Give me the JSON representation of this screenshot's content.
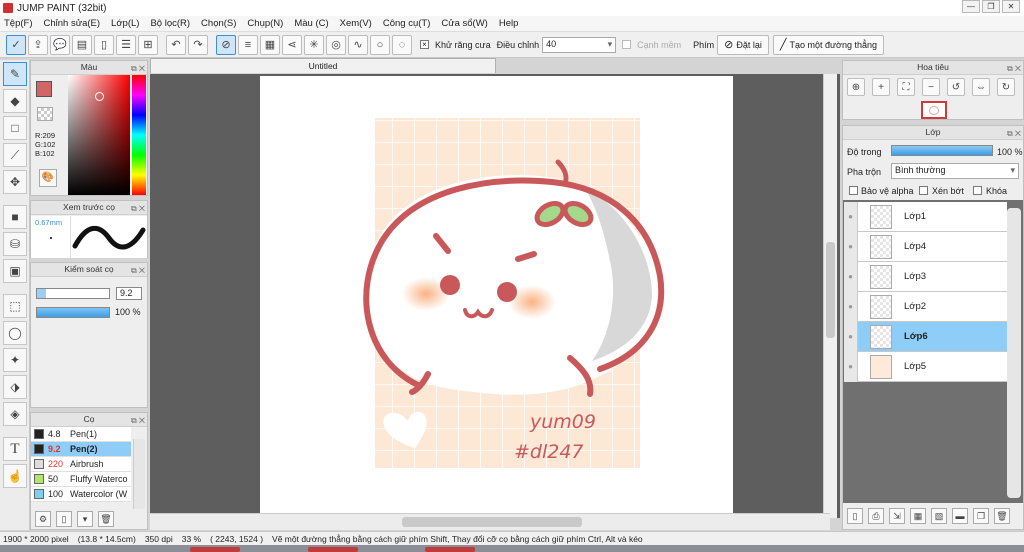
{
  "window": {
    "title": "JUMP PAINT (32bit)"
  },
  "menu": [
    "Tệp(F)",
    "Chỉnh sửa(E)",
    "Lớp(L)",
    "Bộ lọc(R)",
    "Chọn(S)",
    "Chụp(N)",
    "Màu (C)",
    "Xem(V)",
    "Công cụ(T)",
    "Cửa sổ(W)",
    "Help"
  ],
  "toolbar": {
    "antialias_label": "Khử răng cưa",
    "adjust_label": "Điều chỉnh",
    "adjust_value": "40",
    "smooth_label": "Cạnh mềm",
    "key_label": "Phím",
    "reset_label": "Đặt lại",
    "straight_label": "Tạo một đường thẳng"
  },
  "document": {
    "tab_title": "Untitled"
  },
  "color_panel": {
    "title": "Màu",
    "r": "R:209",
    "g": "G:102",
    "b": "B:102",
    "fg_color": "#d16666"
  },
  "brush_preview": {
    "title": "Xem trước cọ",
    "size": "0.67mm"
  },
  "brush_control": {
    "title": "Kiểm soát cọ",
    "size_value": "9.2",
    "opacity_value": "100 %"
  },
  "brushes": {
    "title": "Cọ",
    "items": [
      {
        "size": "4.8",
        "name": "Pen(1)",
        "color": "#222222"
      },
      {
        "size": "9.2",
        "name": "Pen(2)",
        "color": "#222222",
        "selected": true
      },
      {
        "size": "220",
        "name": "Airbrush",
        "color": "#dddddd",
        "size_red": true
      },
      {
        "size": "50",
        "name": "Fluffy Waterco",
        "color": "#b6e36a"
      },
      {
        "size": "100",
        "name": "Watercolor (W",
        "color": "#7fd0f0"
      }
    ]
  },
  "navigator": {
    "title": "Hoa tiêu"
  },
  "layers_panel": {
    "title": "Lớp",
    "opacity_label": "Độ trong",
    "opacity_value": "100 %",
    "blend_label": "Pha trộn",
    "blend_value": "Bình thường",
    "protect_alpha_label": "Bảo vệ alpha",
    "clip_label": "Xén bớt",
    "lock_label": "Khóa",
    "layers": [
      {
        "name": "Lớp1",
        "selected": false
      },
      {
        "name": "Lớp4",
        "selected": false
      },
      {
        "name": "Lớp3",
        "selected": false
      },
      {
        "name": "Lớp2",
        "selected": false
      },
      {
        "name": "Lớp6",
        "selected": true
      },
      {
        "name": "Lớp5",
        "selected": false
      }
    ]
  },
  "artwork": {
    "signature_line1": "yum09",
    "signature_line2": "#dl247"
  },
  "status": {
    "size": "1900 * 2000 pixel",
    "cm": "(13.8 * 14.5cm)",
    "dpi": "350 dpi",
    "zoom": "33 %",
    "coords": "( 2243, 1524 )",
    "hint": "Vẽ một đường thẳng bằng cách giữ phím Shift, Thay đổi cỡ cọ bằng cách giữ phím Ctrl, Alt và kéo"
  }
}
